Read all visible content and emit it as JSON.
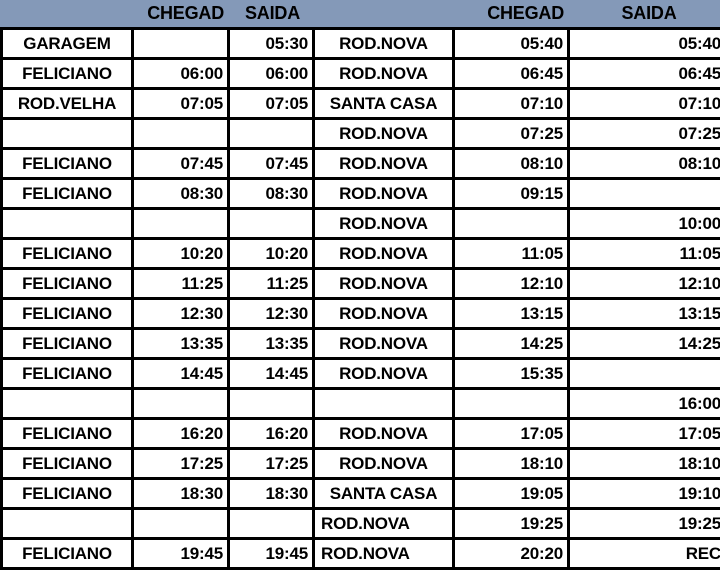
{
  "document": {
    "type": "bus-timetable-spreadsheet",
    "colors": {
      "header_background": "#8499b8",
      "highlight_background": "#ffff00",
      "highlight_text": "#c00000",
      "grid_line": "#000000",
      "cell_background": "#ffffff",
      "text": "#000000"
    }
  },
  "table": {
    "headers": [
      {
        "label": "",
        "align": "left"
      },
      {
        "label": "CHEGAD",
        "align": "right"
      },
      {
        "label": "SAIDA",
        "align": "center"
      },
      {
        "label": "",
        "align": "left"
      },
      {
        "label": "CHEGAD",
        "align": "right"
      },
      {
        "label": "SAIDA",
        "align": "center"
      }
    ],
    "rows": [
      {
        "origin": "GARAGEM",
        "chegada1": "",
        "saida1": "05:30",
        "destino": "ROD.NOVA",
        "destino_style": "plain",
        "chegada2": "05:40",
        "saida2": "05:40"
      },
      {
        "origin": "FELICIANO",
        "chegada1": "06:00",
        "saida1": "06:00",
        "destino": "ROD.NOVA",
        "destino_style": "plain",
        "chegada2": "06:45",
        "saida2": "06:45"
      },
      {
        "origin": "ROD.VELHA",
        "chegada1": "07:05",
        "saida1": "07:05",
        "destino": "SANTA CASA",
        "destino_style": "highlight",
        "chegada2": "07:10",
        "saida2": "07:10"
      },
      {
        "origin": "",
        "chegada1": "",
        "saida1": "",
        "destino": "ROD.NOVA",
        "destino_style": "plain",
        "chegada2": "07:25",
        "saida2": "07:25"
      },
      {
        "origin": "FELICIANO",
        "chegada1": "07:45",
        "saida1": "07:45",
        "destino": "ROD.NOVA",
        "destino_style": "plain",
        "chegada2": "08:10",
        "saida2": "08:10"
      },
      {
        "origin": "FELICIANO",
        "chegada1": "08:30",
        "saida1": "08:30",
        "destino": "ROD.NOVA",
        "destino_style": "plain",
        "chegada2": "09:15",
        "saida2": ""
      },
      {
        "origin": "",
        "chegada1": "",
        "saida1": "",
        "destino": "ROD.NOVA",
        "destino_style": "plain",
        "chegada2": "",
        "saida2": "10:00"
      },
      {
        "origin": "FELICIANO",
        "chegada1": "10:20",
        "saida1": "10:20",
        "destino": "ROD.NOVA",
        "destino_style": "plain",
        "chegada2": "11:05",
        "saida2": "11:05"
      },
      {
        "origin": "FELICIANO",
        "chegada1": "11:25",
        "saida1": "11:25",
        "destino": "ROD.NOVA",
        "destino_style": "plain",
        "chegada2": "12:10",
        "saida2": "12:10"
      },
      {
        "origin": "FELICIANO",
        "chegada1": "12:30",
        "saida1": "12:30",
        "destino": "ROD.NOVA",
        "destino_style": "plain",
        "chegada2": "13:15",
        "saida2": "13:15"
      },
      {
        "origin": "FELICIANO",
        "chegada1": "13:35",
        "saida1": "13:35",
        "destino": "ROD.NOVA",
        "destino_style": "plain",
        "chegada2": "14:25",
        "saida2": "14:25"
      },
      {
        "origin": "FELICIANO",
        "chegada1": "14:45",
        "saida1": "14:45",
        "destino": "ROD.NOVA",
        "destino_style": "plain",
        "chegada2": "15:35",
        "saida2": ""
      },
      {
        "origin": "",
        "chegada1": "",
        "saida1": "",
        "destino": "",
        "destino_style": "plain",
        "chegada2": "",
        "saida2": "16:00"
      },
      {
        "origin": "FELICIANO",
        "chegada1": "16:20",
        "saida1": "16:20",
        "destino": "ROD.NOVA",
        "destino_style": "plain",
        "chegada2": "17:05",
        "saida2": "17:05"
      },
      {
        "origin": "FELICIANO",
        "chegada1": "17:25",
        "saida1": "17:25",
        "destino": "ROD.NOVA",
        "destino_style": "plain",
        "chegada2": "18:10",
        "saida2": "18:10"
      },
      {
        "origin": "FELICIANO",
        "chegada1": "18:30",
        "saida1": "18:30",
        "destino": "SANTA CASA",
        "destino_style": "highlight",
        "chegada2": "19:05",
        "saida2": "19:10"
      },
      {
        "origin": "",
        "chegada1": "",
        "saida1": "",
        "destino": "ROD.NOVA",
        "destino_style": "left",
        "chegada2": "19:25",
        "saida2": "19:25"
      },
      {
        "origin": "FELICIANO",
        "chegada1": "19:45",
        "saida1": "19:45",
        "destino": "ROD.NOVA",
        "destino_style": "left",
        "chegada2": "20:20",
        "saida2": "REC",
        "saida2_style": "red"
      }
    ]
  }
}
